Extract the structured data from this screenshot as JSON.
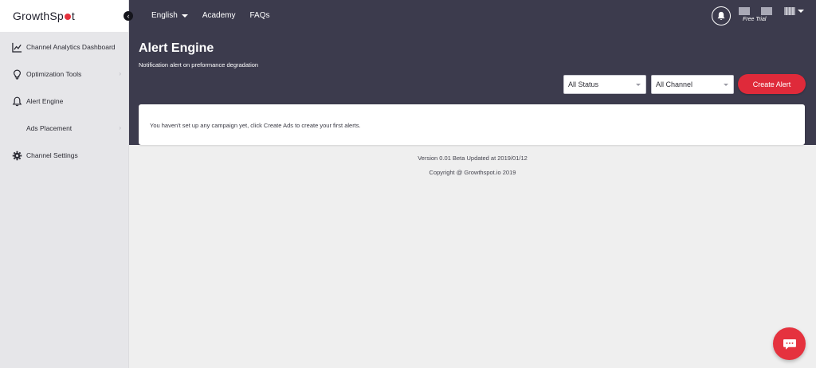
{
  "sidebar": {
    "logo_pre": "GrowthSp",
    "logo_post": "t",
    "items": [
      {
        "label": "Channel Analytics Dashboard",
        "icon": "chart-icon"
      },
      {
        "label": "Optimization Tools",
        "icon": "lightbulb-icon"
      },
      {
        "label": "Alert Engine",
        "icon": "bell-icon"
      },
      {
        "label": "Ads Placement",
        "icon": ""
      },
      {
        "label": "Channel Settings",
        "icon": "gear-icon"
      }
    ]
  },
  "topnav": {
    "language": "English",
    "academy": "Academy",
    "faqs": "FAQs",
    "free_trial": "Free Trial"
  },
  "header": {
    "title": "Alert Engine",
    "subtitle": "Notification alert on preformance degradation"
  },
  "filters": {
    "status": "All Status",
    "channel": "All Channel",
    "create_label": "Create Alert"
  },
  "main": {
    "empty_message": "You haven't set up any campaign yet, click Create Ads to create your first alerts."
  },
  "footer": {
    "version": "Version 0.01 Beta Updated at 2019/01/12",
    "copyright": "Copyright @ Growthspot.io 2019"
  },
  "colors": {
    "accent": "#df2a3a",
    "header_bg": "#3c3b4d",
    "sidebar_bg": "#e6e6e9"
  }
}
